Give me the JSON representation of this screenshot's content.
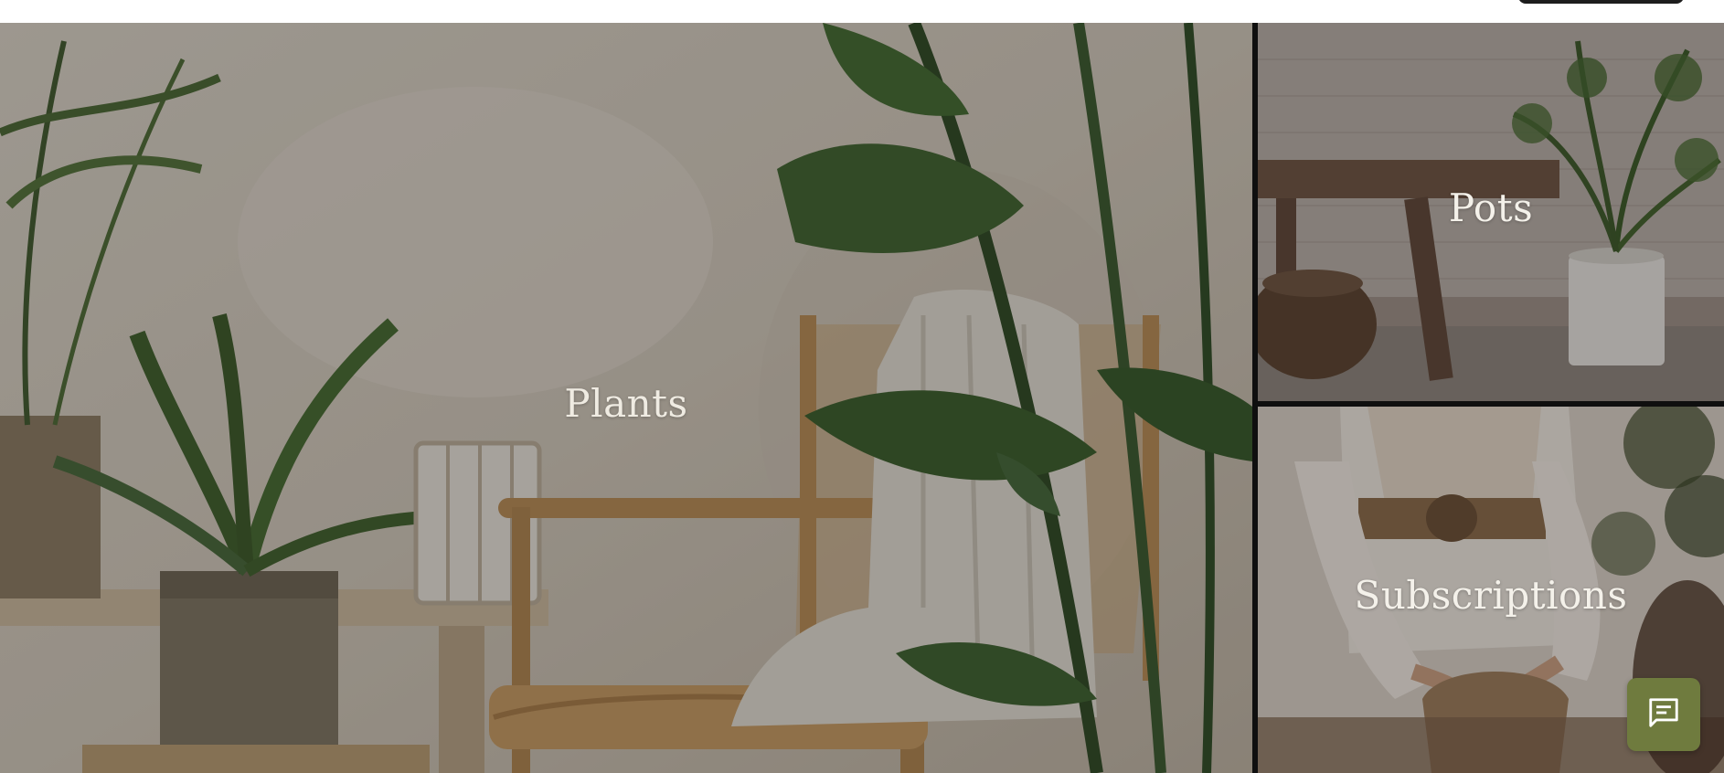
{
  "categories": {
    "plants": {
      "label": "Plants"
    },
    "pots": {
      "label": "Pots"
    },
    "subscriptions": {
      "label": "Subscriptions"
    }
  },
  "chat": {
    "icon": "chat-icon"
  },
  "colors": {
    "chat_button": "#6f7b3e",
    "divider": "#0f0f0f",
    "label_text": "#f4f1ea"
  }
}
